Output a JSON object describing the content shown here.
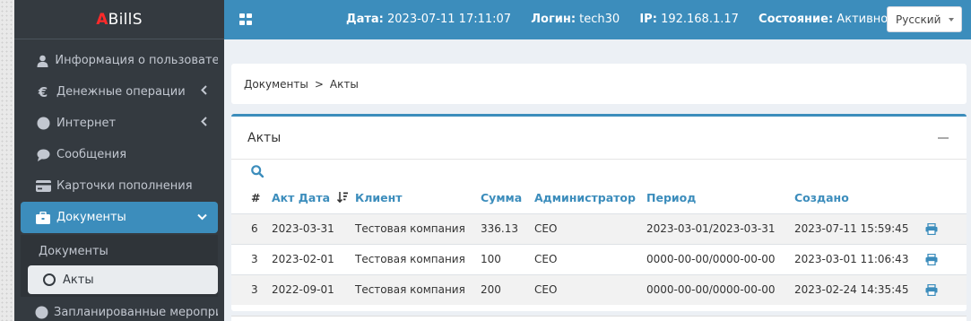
{
  "brand": {
    "first": "A",
    "rest": "BillS"
  },
  "header": {
    "date_label": "Дата:",
    "date_value": "2023-07-11 17:11:07",
    "login_label": "Логин:",
    "login_value": "tech30",
    "ip_label": "IP:",
    "ip_value": "192.168.1.17",
    "state_label": "Состояние:",
    "state_value": "Активно",
    "language": "Русский"
  },
  "sidebar": {
    "items": [
      {
        "label": "Информация о пользователе",
        "icon": "user-icon"
      },
      {
        "label": "Денежные операции",
        "icon": "euro-icon"
      },
      {
        "label": "Интернет",
        "icon": "globe-icon"
      },
      {
        "label": "Сообщения",
        "icon": "comment-icon"
      },
      {
        "label": "Карточки пополнения",
        "icon": "credit-card-icon"
      },
      {
        "label": "Документы",
        "icon": "briefcase-icon"
      },
      {
        "label": "Запланированные мероприятия",
        "icon": "circle-icon"
      }
    ],
    "submenu": {
      "head": "Документы",
      "active": "Акты"
    }
  },
  "breadcrumb": {
    "root": "Документы",
    "sep": ">",
    "current": "Акты"
  },
  "card": {
    "title": "Акты",
    "columns": [
      "#",
      "Акт Дата",
      "Клиент",
      "Сумма",
      "Администратор",
      "Период",
      "Создано"
    ],
    "rows": [
      {
        "num": "6",
        "date": "2023-03-31",
        "client": "Тестовая компания",
        "sum": "336.13",
        "admin": "CEO",
        "period": "2023-03-01/2023-03-31",
        "created": "2023-07-11 15:59:45"
      },
      {
        "num": "3",
        "date": "2023-02-01",
        "client": "Тестовая компания",
        "sum": "100",
        "admin": "CEO",
        "period": "0000-00-00/0000-00-00",
        "created": "2023-03-01 11:06:43"
      },
      {
        "num": "3",
        "date": "2022-09-01",
        "client": "Тестовая компания",
        "sum": "200",
        "admin": "CEO",
        "period": "0000-00-00/0000-00-00",
        "created": "2023-02-24 14:35:45"
      }
    ]
  },
  "colors": {
    "accent": "#3c8dbc",
    "sidebar_bg": "#343a40",
    "brand_red": "#ff2a2a"
  }
}
